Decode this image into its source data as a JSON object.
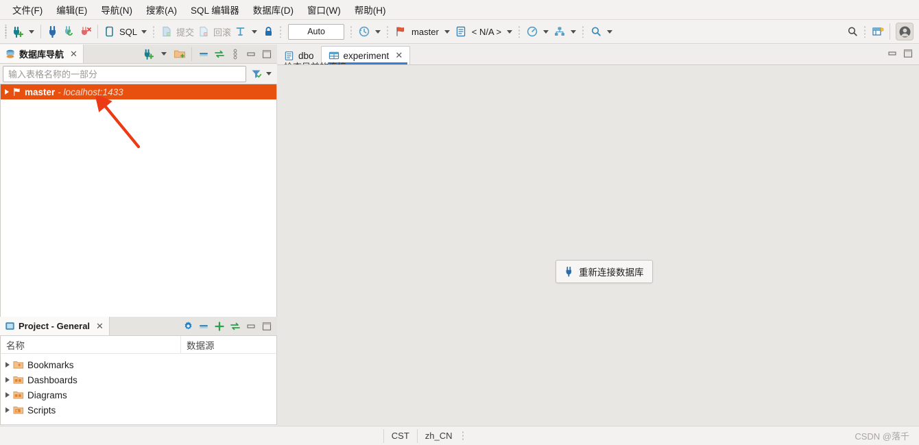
{
  "menubar": {
    "items": [
      {
        "label": "文件(F)",
        "name": "menu-file"
      },
      {
        "label": "编辑(E)",
        "name": "menu-edit"
      },
      {
        "label": "导航(N)",
        "name": "menu-navigate"
      },
      {
        "label": "搜索(A)",
        "name": "menu-search"
      },
      {
        "label": "SQL 编辑器",
        "name": "menu-sql-editor"
      },
      {
        "label": "数据库(D)",
        "name": "menu-database"
      },
      {
        "label": "窗口(W)",
        "name": "menu-window"
      },
      {
        "label": "帮助(H)",
        "name": "menu-help"
      }
    ]
  },
  "toolbar": {
    "new_connection_icon": "plug-plus-icon",
    "connect_icon": "plug-icon",
    "refresh_connection_icon": "plug-refresh-icon",
    "disconnect_icon": "plug-disconnect-icon",
    "sql_editor_icon": "sql-script-icon",
    "sql_label": "SQL",
    "commit_icon": "commit-icon",
    "commit_label": "提交",
    "rollback_icon": "rollback-icon",
    "rollback_label": "回滚",
    "transaction_mode_icon": "transaction-mode-icon",
    "lock_icon": "lock-icon",
    "auto_value": "Auto",
    "history_icon": "history-clock-icon",
    "bookmark_icon": "bookmark-flag-icon",
    "database_value": "master",
    "schema_icon": "schema-icon",
    "schema_value": "< N/A >",
    "performance_icon": "dashboard-gauge-icon",
    "data_transfer_icon": "data-transfer-icon",
    "search_icon": "search-icon",
    "global_search_icon": "search-icon",
    "grid_icon": "grid-settings-icon",
    "avatar_icon": "user-avatar-icon"
  },
  "navigator": {
    "tab_label": "数据库导航",
    "tab_close": "✕",
    "tab_icon": "database-navigator-icon",
    "tools": {
      "new_connection_icon": "plug-plus-icon",
      "new_folder_icon": "folder-plus-icon",
      "collapse_all_icon": "collapse-all-icon",
      "link_editor_icon": "link-with-editor-icon",
      "view_menu_icon": "view-menu-icon",
      "minimize_icon": "minimize-icon",
      "maximize_icon": "maximize-icon"
    },
    "filter_placeholder": "输入表格名称的一部分",
    "filter_icon": "filter-icon",
    "filter_caret_icon": "chevron-down-icon",
    "tree": [
      {
        "name": "master",
        "detail": "- localhost:1433",
        "icon": "sql-server-connection-icon",
        "selected": true,
        "expander": "collapsed"
      }
    ]
  },
  "project_panel": {
    "tab_label": "Project - General",
    "tab_close": "✕",
    "tab_icon": "project-icon",
    "tools": {
      "settings_icon": "gear-icon",
      "collapse_all_icon": "collapse-all-icon",
      "add_icon": "plus-icon",
      "link_editor_icon": "link-with-editor-icon",
      "minimize_icon": "minimize-icon",
      "maximize_icon": "maximize-icon"
    },
    "columns": [
      "名称",
      "数据源"
    ],
    "rows": [
      {
        "label": "Bookmarks",
        "icon": "bookmarks-folder-icon"
      },
      {
        "label": "Dashboards",
        "icon": "dashboards-folder-icon"
      },
      {
        "label": "Diagrams",
        "icon": "diagrams-folder-icon"
      },
      {
        "label": "Scripts",
        "icon": "scripts-folder-icon"
      }
    ]
  },
  "editor": {
    "tabs": [
      {
        "label": "dbo",
        "icon": "schema-editor-icon",
        "active": false,
        "closable": false
      },
      {
        "label": "experiment",
        "icon": "table-editor-icon",
        "active": true,
        "closable": true,
        "close": "✕"
      }
    ],
    "obscured_text": "检查目前的连接",
    "minimize_icon": "minimize-icon",
    "maximize_icon": "maximize-icon",
    "reconnect_button": {
      "label": "重新连接数据库",
      "icon": "plug-icon"
    }
  },
  "statusbar": {
    "timezone": "CST",
    "locale": "zh_CN",
    "resize_grip": "resize-grip",
    "watermark": "CSDN @落千"
  },
  "annotation": {
    "arrow_color": "#e8301a",
    "name": "red-pointer-arrow"
  },
  "colors": {
    "selection_orange": "#e8500f",
    "accent_blue": "#3b7fd4",
    "chrome": "#f3f2f1",
    "editor_bg": "#e9e7e4"
  }
}
